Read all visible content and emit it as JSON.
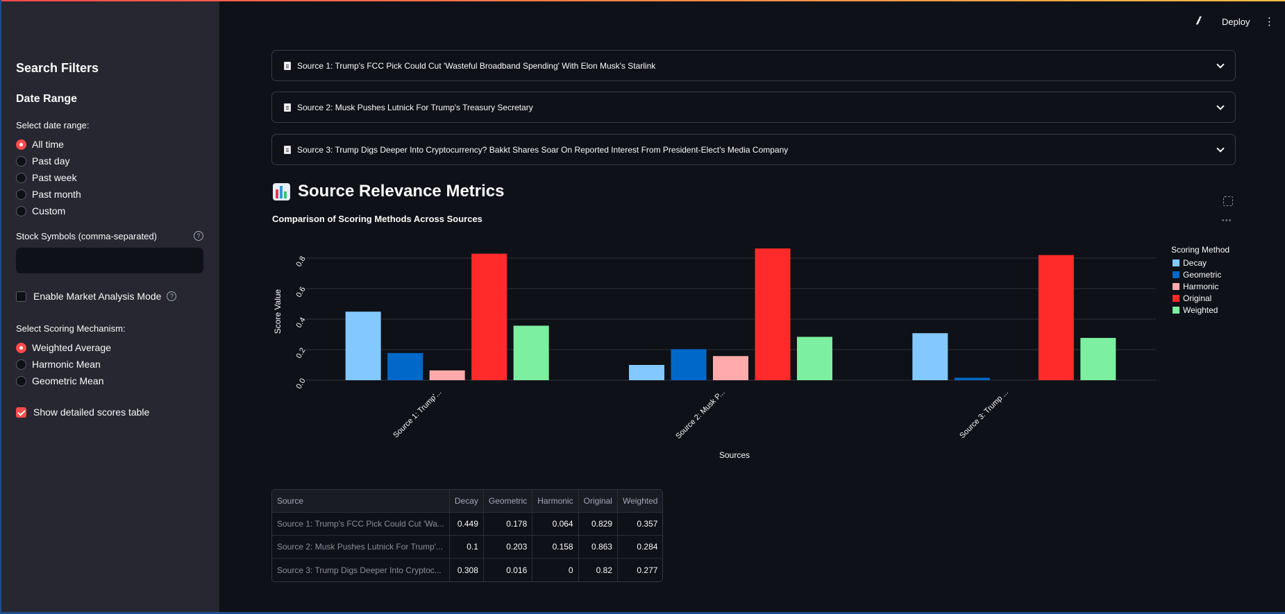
{
  "header": {
    "deploy_label": "Deploy"
  },
  "sidebar": {
    "title": "Search Filters",
    "date_range_heading": "Date Range",
    "date_range_label": "Select date range:",
    "date_options": [
      "All time",
      "Past day",
      "Past week",
      "Past month",
      "Custom"
    ],
    "date_selected": "All time",
    "stock_label": "Stock Symbols (comma-separated)",
    "stock_value": "",
    "market_mode_label": "Enable Market Analysis Mode",
    "market_mode_checked": false,
    "scoring_label": "Select Scoring Mechanism:",
    "scoring_options": [
      "Weighted Average",
      "Harmonic Mean",
      "Geometric Mean"
    ],
    "scoring_selected": "Weighted Average",
    "detail_table_label": "Show detailed scores table",
    "detail_table_checked": true
  },
  "sources": [
    {
      "label": "Source 1: Trump's FCC Pick Could Cut 'Wasteful Broadband Spending' With Elon Musk's Starlink"
    },
    {
      "label": "Source 2: Musk Pushes Lutnick For Trump's Treasury Secretary"
    },
    {
      "label": "Source 3: Trump Digs Deeper Into Cryptocurrency? Bakkt Shares Soar On Reported Interest From President-Elect's Media Company"
    }
  ],
  "section_title": "Source Relevance Metrics",
  "chart_data": {
    "type": "bar",
    "title": "Comparison of Scoring Methods Across Sources",
    "xlabel": "Sources",
    "ylabel": "Score Value",
    "categories": [
      "Source 1: Trump'...",
      "Source 2: Musk P...",
      "Source 3: Trump ..."
    ],
    "ylim": [
      0,
      0.9
    ],
    "yticks": [
      "0.0",
      "0.2",
      "0.4",
      "0.6",
      "0.8"
    ],
    "grid": true,
    "legend_title": "Scoring Method",
    "legend_position": "right",
    "series": [
      {
        "name": "Decay",
        "color": "#83c9ff",
        "values": [
          0.449,
          0.1,
          0.308
        ]
      },
      {
        "name": "Geometric",
        "color": "#0068c9",
        "values": [
          0.178,
          0.203,
          0.016
        ]
      },
      {
        "name": "Harmonic",
        "color": "#ffabab",
        "values": [
          0.064,
          0.158,
          0
        ]
      },
      {
        "name": "Original",
        "color": "#ff2b2b",
        "values": [
          0.829,
          0.863,
          0.82
        ]
      },
      {
        "name": "Weighted",
        "color": "#7defa1",
        "values": [
          0.357,
          0.284,
          0.277
        ]
      }
    ]
  },
  "table": {
    "columns": [
      "Source",
      "Decay",
      "Geometric",
      "Harmonic",
      "Original",
      "Weighted"
    ],
    "rows": [
      [
        "Source 1: Trump's FCC Pick Could Cut 'Wa...",
        "0.449",
        "0.178",
        "0.064",
        "0.829",
        "0.357"
      ],
      [
        "Source 2: Musk Pushes Lutnick For Trump'...",
        "0.1",
        "0.203",
        "0.158",
        "0.863",
        "0.284"
      ],
      [
        "Source 3: Trump Digs Deeper Into Cryptoc...",
        "0.308",
        "0.016",
        "0",
        "0.82",
        "0.277"
      ]
    ]
  }
}
